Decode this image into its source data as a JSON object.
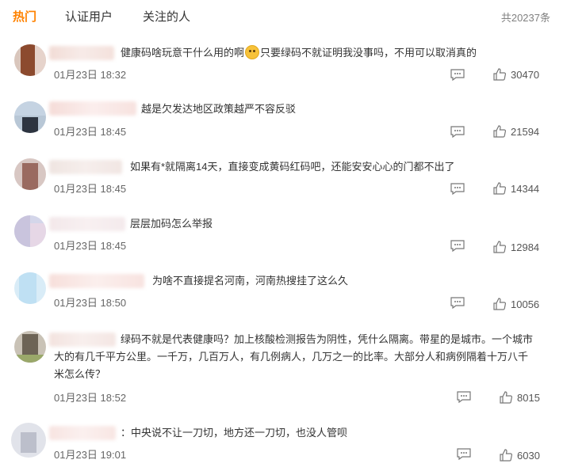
{
  "tabs": [
    {
      "label": "热门",
      "active": true
    },
    {
      "label": "认证用户",
      "active": false
    },
    {
      "label": "关注的人",
      "active": false
    }
  ],
  "total": "共20237条",
  "comments": [
    {
      "text_a": "健康码啥玩意干什么用的啊",
      "text_b": "只要绿码不就证明我没事吗，不用可以取消真的",
      "time": "01月23日 18:32",
      "likes": "30470"
    },
    {
      "text": "越是欠发达地区政策越严不容反驳",
      "time": "01月23日 18:45",
      "likes": "21594"
    },
    {
      "text": "如果有*就隔离14天，直接变成黄码红码吧，还能安安心心的门都不出了",
      "time": "01月23日 18:45",
      "likes": "14344"
    },
    {
      "text": "层层加码怎么举报",
      "time": "01月23日 18:45",
      "likes": "12984"
    },
    {
      "text": "为啥不直接提名河南，河南热搜挂了这么久",
      "time": "01月23日 18:50",
      "likes": "10056"
    },
    {
      "text_l1": "绿码不就是代表健康吗？加上核酸检测报告为阴性，凭什么隔离。带星的是城市。一个城市",
      "text_l2": "大的有几千平方公里。一千万，几百万人，有几例病人，几万之一的比率。大部分人和病例隔着十万八千",
      "text_l3": "米怎么传？",
      "time": "01月23日 18:52",
      "likes": "8015"
    },
    {
      "text": "：中央说不让一刀切，地方还一刀切，也没人管呗",
      "time": "01月23日 19:01",
      "likes": "6030"
    }
  ],
  "icons": {
    "reply": "comment-icon",
    "like": "thumbs-up-icon",
    "emoji": "surprised-emoji-icon"
  },
  "colors": {
    "accent": "#ff8200",
    "text": "#333333",
    "meta": "#666666"
  }
}
